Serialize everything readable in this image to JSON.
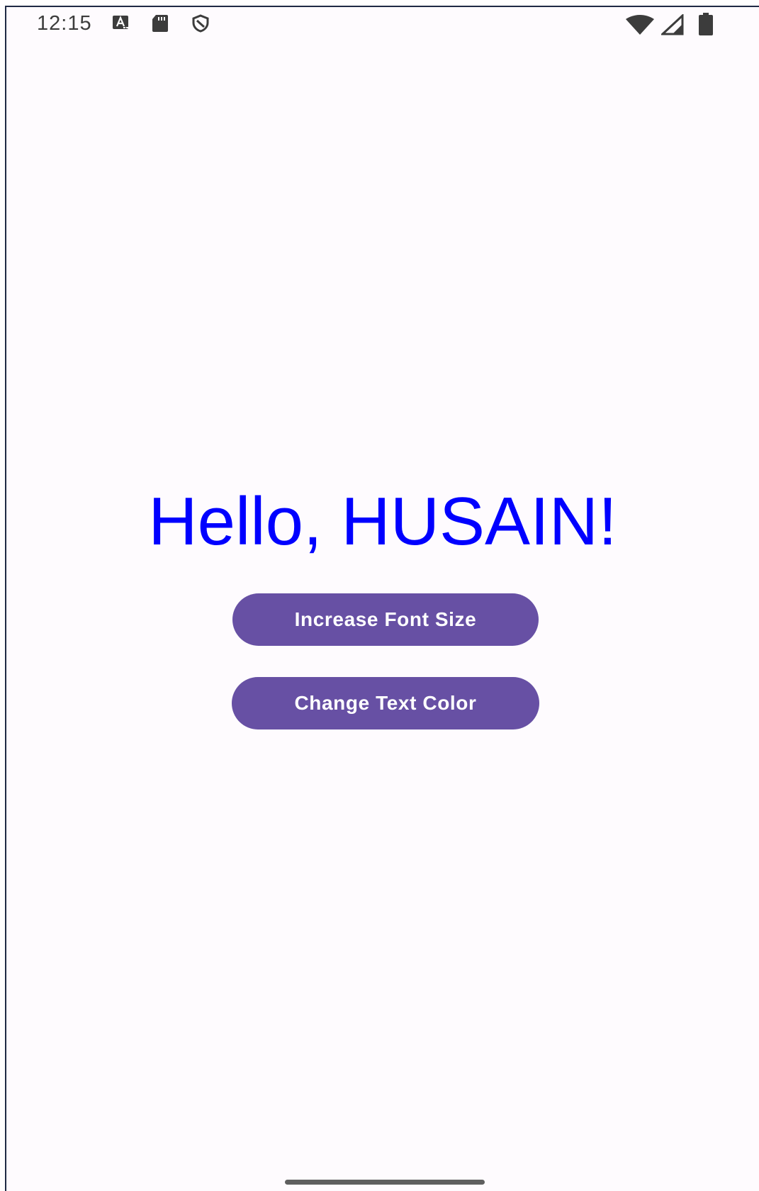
{
  "status_bar": {
    "time": "12:15",
    "left_icons": [
      "keyboard-a-icon",
      "sd-card-icon",
      "shield-icon"
    ],
    "right_icons": [
      "wifi-icon",
      "cell-signal-icon",
      "battery-icon"
    ]
  },
  "main": {
    "greeting": "Hello, HUSAIN!",
    "greeting_color": "#0000FF"
  },
  "buttons": {
    "increase_font_size": "Increase Font Size",
    "change_text_color": "Change Text Color",
    "button_color": "#6750A4"
  }
}
